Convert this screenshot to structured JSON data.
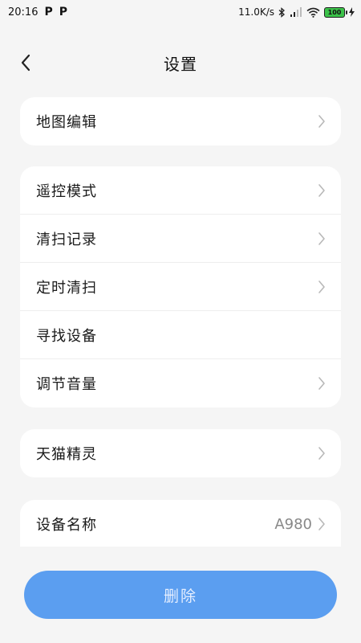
{
  "status_bar": {
    "time": "20:16",
    "app_icons": [
      "P",
      "P"
    ],
    "network_speed": "11.0K/s",
    "battery": "100"
  },
  "header": {
    "title": "设置",
    "back_icon": "chevron-left-icon"
  },
  "groups": [
    {
      "items": [
        {
          "label": "地图编辑",
          "chevron": true
        }
      ]
    },
    {
      "items": [
        {
          "label": "遥控模式",
          "chevron": true
        },
        {
          "label": "清扫记录",
          "chevron": true
        },
        {
          "label": "定时清扫",
          "chevron": true
        },
        {
          "label": "寻找设备",
          "chevron": false
        },
        {
          "label": "调节音量",
          "chevron": true
        }
      ]
    },
    {
      "items": [
        {
          "label": "天猫精灵",
          "chevron": true
        }
      ]
    },
    {
      "items": [
        {
          "label": "设备名称",
          "value": "A980",
          "chevron": true
        }
      ]
    }
  ],
  "delete_button": {
    "label": "删除"
  },
  "colors": {
    "background": "#f5f5f5",
    "card": "#ffffff",
    "primary_button": "#5b9ef0",
    "chevron": "#b8b8b8"
  }
}
